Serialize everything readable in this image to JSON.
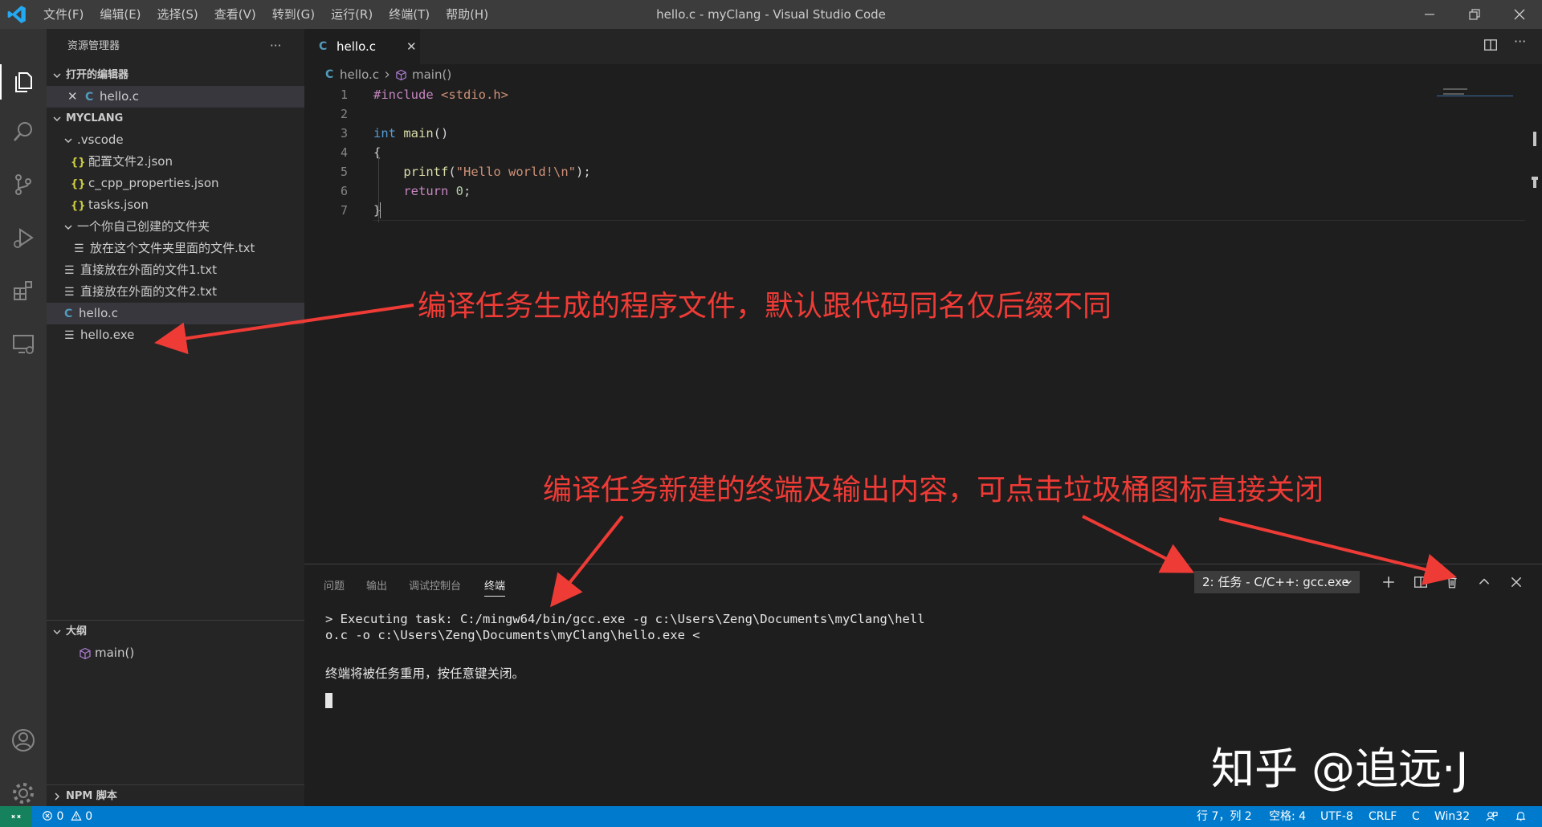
{
  "window": {
    "title": "hello.c - myClang - Visual Studio Code",
    "menu": [
      "文件(F)",
      "编辑(E)",
      "选择(S)",
      "查看(V)",
      "转到(G)",
      "运行(R)",
      "终端(T)",
      "帮助(H)"
    ]
  },
  "sidebar": {
    "title": "资源管理器",
    "more": "···",
    "open_editors_header": "打开的编辑器",
    "open_editor_file": "hello.c",
    "project_header": "MYCLANG",
    "tree": {
      "vscode_folder": ".vscode",
      "file_json1": "配置文件2.json",
      "file_json2": "c_cpp_properties.json",
      "file_json3": "tasks.json",
      "custom_folder": "一个你自己创建的文件夹",
      "file_inner_txt": "放在这个文件夹里面的文件.txt",
      "file_txt1": "直接放在外面的文件1.txt",
      "file_txt2": "直接放在外面的文件2.txt",
      "file_hello_c": "hello.c",
      "file_hello_exe": "hello.exe"
    },
    "outline_header": "大纲",
    "outline_item": "main()",
    "npm_header": "NPM 脚本"
  },
  "editor": {
    "tab_label": "hello.c",
    "breadcrumb_file": "hello.c",
    "breadcrumb_symbol": "main()",
    "lines": {
      "l1": "1",
      "l2": "2",
      "l3": "3",
      "l4": "4",
      "l5": "5",
      "l6": "6",
      "l7": "7"
    },
    "code": {
      "include_kw": "#include",
      "include_hdr": " <stdio.h>",
      "int_kw": "int",
      "main_fn": " main",
      "main_paren": "()",
      "brace_open": "{",
      "printf_fn": "    printf",
      "printf_open": "(",
      "printf_str": "\"Hello world!\\n\"",
      "printf_close": ");",
      "return_kw": "    return",
      "return_val": " 0",
      "return_semi": ";",
      "brace_close": "}"
    }
  },
  "panel": {
    "tabs": [
      "问题",
      "输出",
      "调试控制台",
      "终端"
    ],
    "terminal_select": "2: 任务 - C/C++: gcc.exe",
    "terminal_lines": [
      "> Executing task: C:/mingw64/bin/gcc.exe -g c:\\Users\\Zeng\\Documents\\myClang\\hell",
      "o.c -o c:\\Users\\Zeng\\Documents\\myClang\\hello.exe <",
      "终端将被任务重用，按任意键关闭。"
    ]
  },
  "statusbar": {
    "errors": "0",
    "warnings": "0",
    "position": "行 7，列 2",
    "indent": "空格: 4",
    "encoding": "UTF-8",
    "eol": "CRLF",
    "language": "C",
    "platform": "Win32"
  },
  "annotations": {
    "exe_note": "编译任务生成的程序文件，默认跟代码同名仅后缀不同",
    "terminal_note": "编译任务新建的终端及输出内容，可点击垃圾桶图标直接关闭",
    "watermark": "知乎 @追远·J"
  },
  "colors": {
    "accent": "#007acc",
    "annotation": "#ef3b36",
    "remote": "#16825d"
  }
}
